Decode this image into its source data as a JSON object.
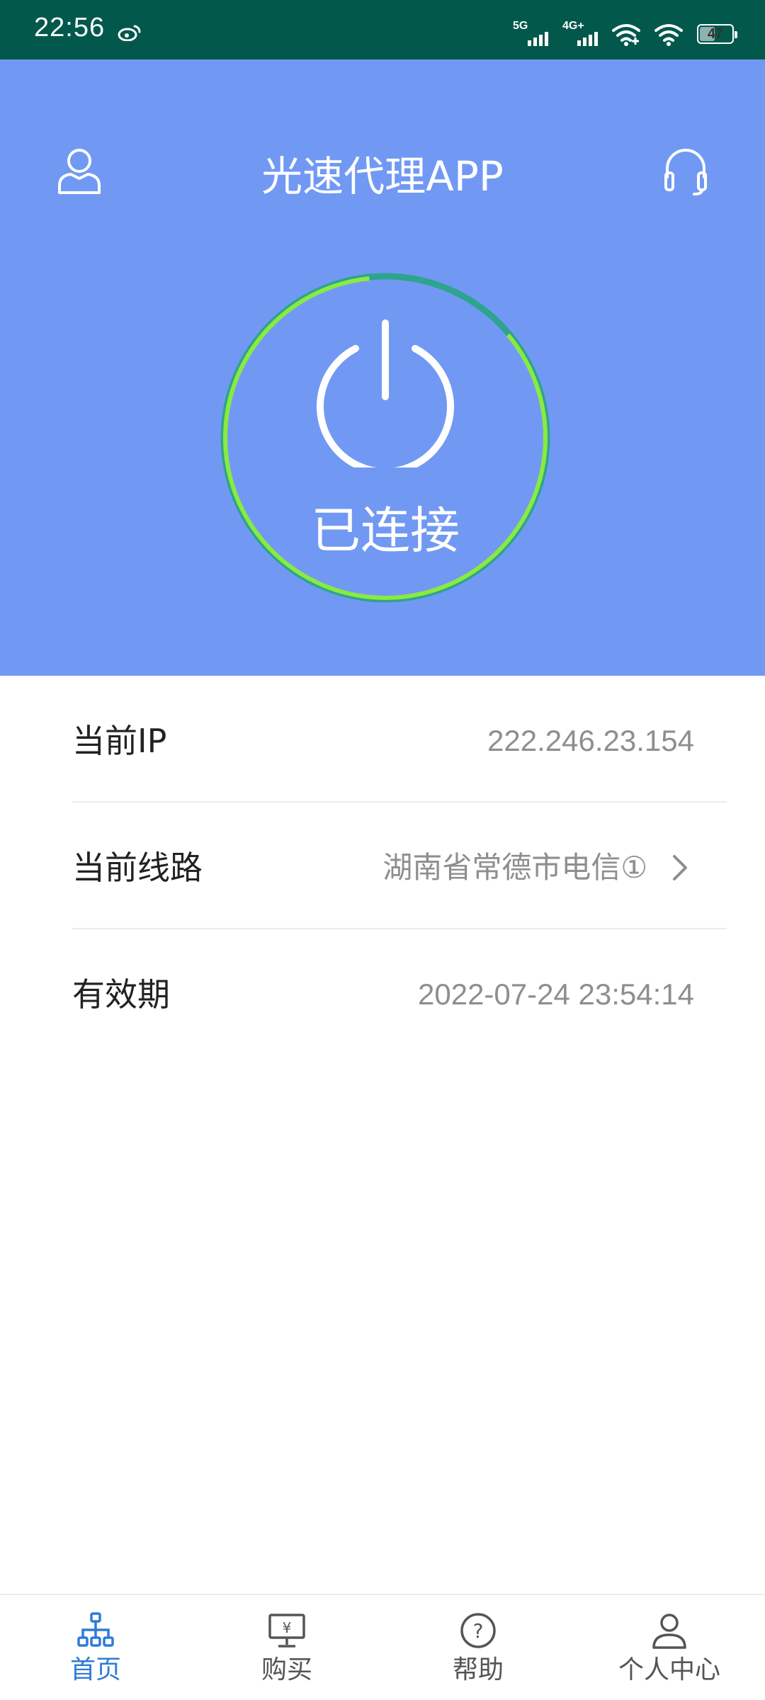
{
  "status_bar": {
    "time": "22:56",
    "net1": "5G",
    "net2": "4G+",
    "battery": "47",
    "battery_level_percent": 47
  },
  "header": {
    "title": "光速代理APP"
  },
  "connection": {
    "status": "已连接"
  },
  "info": {
    "rows": [
      {
        "label": "当前IP",
        "value": "222.246.23.154"
      },
      {
        "label": "当前线路",
        "value": "湖南省常德市电信①"
      },
      {
        "label": "有效期",
        "value": "2022-07-24 23:54:14"
      }
    ]
  },
  "nav": {
    "items": [
      {
        "label": "首页",
        "icon": "network-icon"
      },
      {
        "label": "购买",
        "icon": "buy-monitor-icon"
      },
      {
        "label": "帮助",
        "icon": "help-icon"
      },
      {
        "label": "个人中心",
        "icon": "user-icon"
      }
    ]
  },
  "colors": {
    "status_bar": "#03584C",
    "hero": "#7199F4",
    "ring": "#8BEA3F",
    "active_nav": "#2E7BD6"
  }
}
